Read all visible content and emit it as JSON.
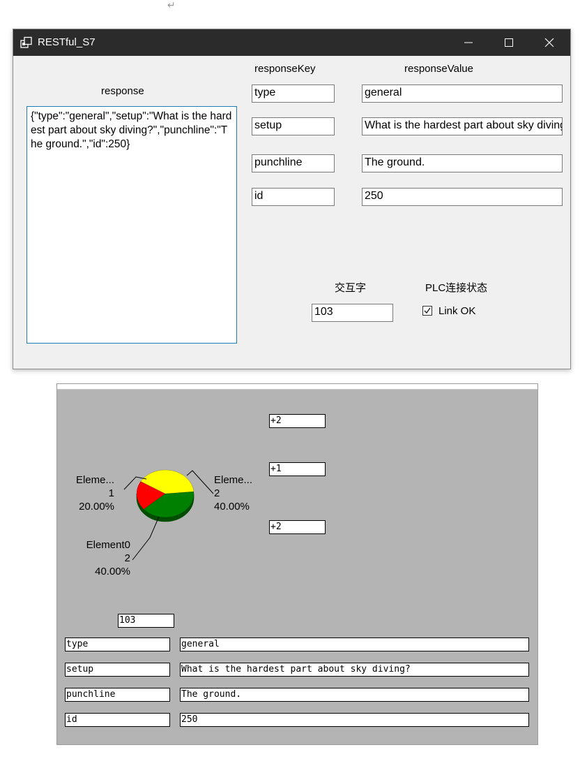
{
  "return_mark": "↵",
  "window": {
    "title": "RESTful_S7"
  },
  "labels": {
    "response": "response",
    "response_key": "responseKey",
    "response_value": "responseValue",
    "interaction_word": "交互字",
    "plc_status": "PLC连接状态"
  },
  "response_text": "{\"type\":\"general\",\"setup\":\"What is the hardest part about sky diving?\",\"punchline\":\"The ground.\",\"id\":250}",
  "rows": [
    {
      "key": "type",
      "value": "general"
    },
    {
      "key": "setup",
      "value": "What is the hardest part about sky diving?"
    },
    {
      "key": "punchline",
      "value": "The ground."
    },
    {
      "key": "id",
      "value": "250"
    }
  ],
  "interaction_value": "103",
  "link": {
    "checked": true,
    "label": "Link OK"
  },
  "hmi": {
    "io_fields": [
      "+2",
      "+1",
      "+2"
    ],
    "interaction_value": "103",
    "rows": [
      {
        "key": "type",
        "value": "general"
      },
      {
        "key": "setup",
        "value": "What is the hardest part about sky diving?"
      },
      {
        "key": "punchline",
        "value": "The ground."
      },
      {
        "key": "id",
        "value": "250"
      }
    ]
  },
  "chart_data": {
    "type": "pie",
    "slices": [
      {
        "label": "Element0",
        "value": 2,
        "percent": "40.00%",
        "color": "#008000"
      },
      {
        "label": "Eleme...",
        "value": 1,
        "percent": "20.00%",
        "color": "#ff0000"
      },
      {
        "label": "Eleme...",
        "value": 2,
        "percent": "40.00%",
        "color": "#ffff00"
      }
    ]
  }
}
